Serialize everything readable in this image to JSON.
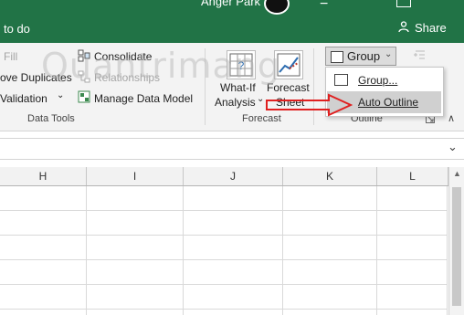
{
  "titlebar": {
    "tell_me": "to do",
    "user_name": "Anger Park",
    "window_control": "−",
    "share_label": "Share"
  },
  "watermark": "Quantrimang",
  "ribbon": {
    "data_tools": {
      "fill_label": "Fill",
      "remove_duplicates_label": "ove Duplicates",
      "validation_label": "Validation",
      "consolidate_label": "Consolidate",
      "relationships_label": "Relationships",
      "manage_data_model_label": "Manage Data Model",
      "group_label": "Data Tools"
    },
    "forecast": {
      "what_if_label": "What-If",
      "what_if_label2": "Analysis",
      "forecast_sheet_label": "Forecast",
      "forecast_sheet_label2": "Sheet",
      "group_label": "Forecast"
    },
    "outline": {
      "group_button_label": "Group",
      "group_label": "Outline"
    }
  },
  "dropdown": {
    "items": [
      {
        "label": "Group..."
      },
      {
        "label": "Auto Outline"
      }
    ]
  },
  "columns": [
    "H",
    "I",
    "J",
    "K",
    "L"
  ],
  "colors": {
    "title_bar": "#217346",
    "arrow": "#e02020",
    "highlight": "#d0d0d0"
  }
}
